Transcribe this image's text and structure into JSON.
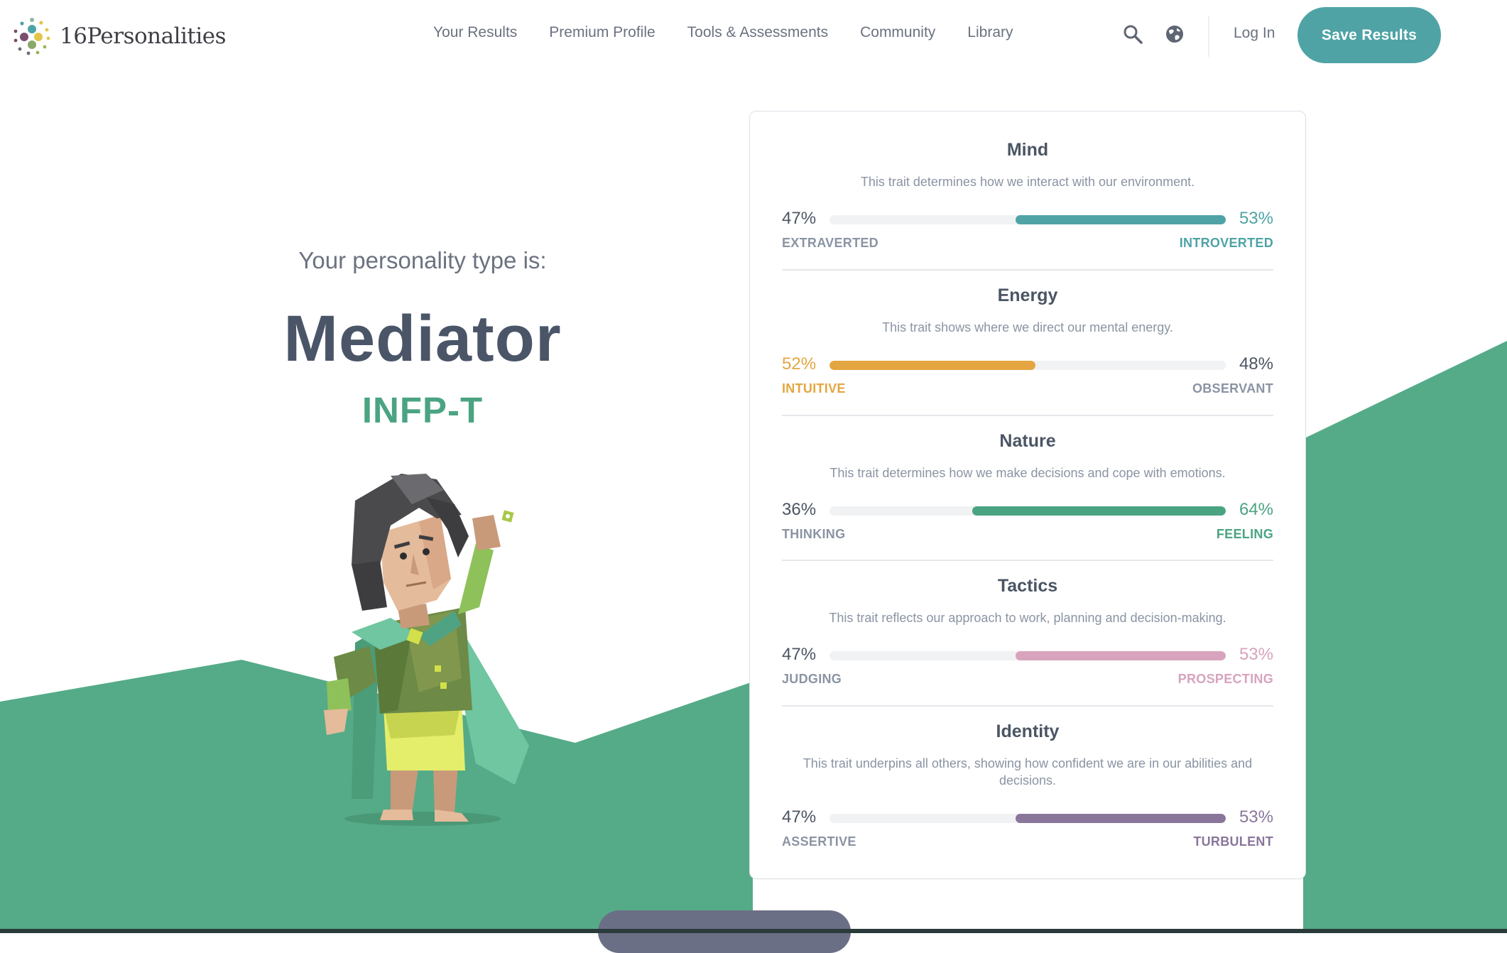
{
  "header": {
    "logo_text": "16Personalities",
    "nav": [
      {
        "label": "Your Results"
      },
      {
        "label": "Premium Profile"
      },
      {
        "label": "Tools & Assessments"
      },
      {
        "label": "Community"
      },
      {
        "label": "Library"
      }
    ],
    "icons": {
      "search": "search-icon",
      "language": "globe-icon"
    },
    "login_label": "Log In",
    "save_label": "Save Results"
  },
  "hero": {
    "intro": "Your personality type is:",
    "type_name": "Mediator",
    "type_code": "INFP-T"
  },
  "colors": {
    "teal": "#4fa3a5",
    "green": "#4aa482",
    "yellow": "#e4a640",
    "pink": "#d7a3bd",
    "purple": "#89769a",
    "background_green": "#55ab88"
  },
  "traits": [
    {
      "name": "Mind",
      "description": "This trait determines how we interact with our environment.",
      "left_pct": "47%",
      "right_pct": "53%",
      "left_label": "EXTRAVERTED",
      "right_label": "INTROVERTED",
      "dominant": "right",
      "dominant_value": 0.53,
      "color": "#4fa3a5"
    },
    {
      "name": "Energy",
      "description": "This trait shows where we direct our mental energy.",
      "left_pct": "52%",
      "right_pct": "48%",
      "left_label": "INTUITIVE",
      "right_label": "OBSERVANT",
      "dominant": "left",
      "dominant_value": 0.52,
      "color": "#e4a640"
    },
    {
      "name": "Nature",
      "description": "This trait determines how we make decisions and cope with emotions.",
      "left_pct": "36%",
      "right_pct": "64%",
      "left_label": "THINKING",
      "right_label": "FEELING",
      "dominant": "right",
      "dominant_value": 0.64,
      "color": "#4aa482"
    },
    {
      "name": "Tactics",
      "description": "This trait reflects our approach to work, planning and decision-making.",
      "left_pct": "47%",
      "right_pct": "53%",
      "left_label": "JUDGING",
      "right_label": "PROSPECTING",
      "dominant": "right",
      "dominant_value": 0.53,
      "color": "#d7a3bd"
    },
    {
      "name": "Identity",
      "description": "This trait underpins all others, showing how confident we are in our abilities and decisions.",
      "left_pct": "47%",
      "right_pct": "53%",
      "left_label": "ASSERTIVE",
      "right_label": "TURBULENT",
      "dominant": "right",
      "dominant_value": 0.53,
      "color": "#89769a"
    }
  ]
}
